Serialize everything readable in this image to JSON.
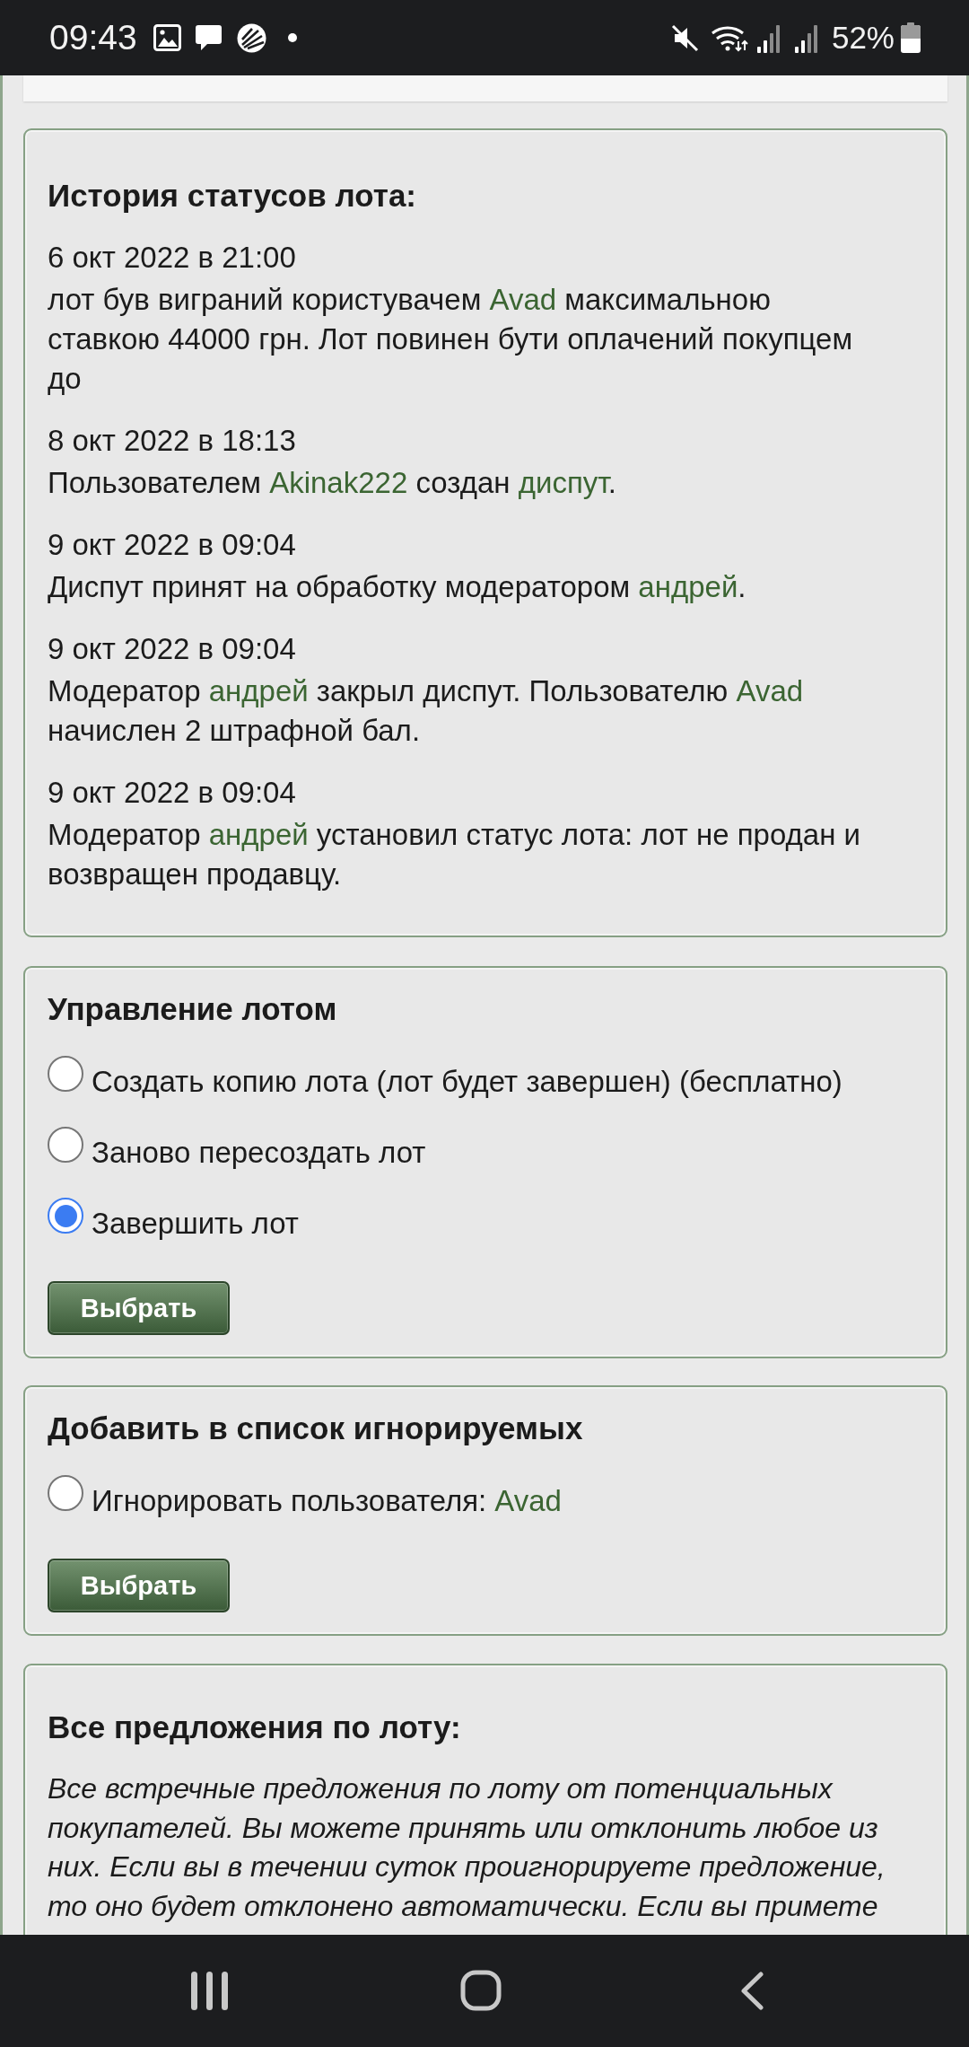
{
  "status_bar": {
    "time": "09:43",
    "battery": "52%"
  },
  "history": {
    "title": "История статусов лота:",
    "entries": [
      {
        "date": "6 окт 2022 в 21:00",
        "parts": [
          {
            "kind": "text",
            "text": "лот був виграний користувачем "
          },
          {
            "kind": "link",
            "text": "Avad"
          },
          {
            "kind": "text",
            "text": " максимальною ставкою 44000 грн. Лот повинен бути оплачений покупцем до"
          }
        ]
      },
      {
        "date": "8 окт 2022 в 18:13",
        "parts": [
          {
            "kind": "text",
            "text": "Пользователем "
          },
          {
            "kind": "link",
            "text": "Akinak222"
          },
          {
            "kind": "text",
            "text": " создан "
          },
          {
            "kind": "link",
            "text": "диспут"
          },
          {
            "kind": "text",
            "text": "."
          }
        ]
      },
      {
        "date": "9 окт 2022 в 09:04",
        "parts": [
          {
            "kind": "text",
            "text": "Диспут принят на обработку модератором "
          },
          {
            "kind": "link",
            "text": "андрей"
          },
          {
            "kind": "text",
            "text": "."
          }
        ]
      },
      {
        "date": "9 окт 2022 в 09:04",
        "parts": [
          {
            "kind": "text",
            "text": "Модератор "
          },
          {
            "kind": "link",
            "text": "андрей"
          },
          {
            "kind": "text",
            "text": " закрыл диспут. Пользователю "
          },
          {
            "kind": "link",
            "text": "Avad"
          },
          {
            "kind": "text",
            "text": " начислен 2 штрафной бал."
          }
        ]
      },
      {
        "date": "9 окт 2022 в 09:04",
        "parts": [
          {
            "kind": "text",
            "text": "Модератор "
          },
          {
            "kind": "link",
            "text": "андрей"
          },
          {
            "kind": "text",
            "text": " установил статус лота: лот не продан и возвращен продавцу."
          }
        ]
      }
    ]
  },
  "lot_management": {
    "title": "Управление лотом",
    "options": [
      {
        "label": "Создать копию лота (лот будет завершен) (бесплатно)",
        "selected": false
      },
      {
        "label": "Заново пересоздать лот",
        "selected": false
      },
      {
        "label": "Завершить лот",
        "selected": true
      }
    ],
    "button": "Выбрать"
  },
  "ignore_list": {
    "title": "Добавить в список игнорируемых",
    "options": [
      {
        "label": "Игнорировать пользователя:",
        "user": "Avad",
        "selected": false
      }
    ],
    "button": "Выбрать"
  },
  "offers": {
    "title": "Все предложения по лоту:",
    "description": "Все встречные предложения по лоту от потенциальных покупателей. Вы можете принять или отклонить любое из них. Если вы в течении суток проигнорируете предложение, то оно будет отклонено автоматически. Если вы примете"
  }
}
